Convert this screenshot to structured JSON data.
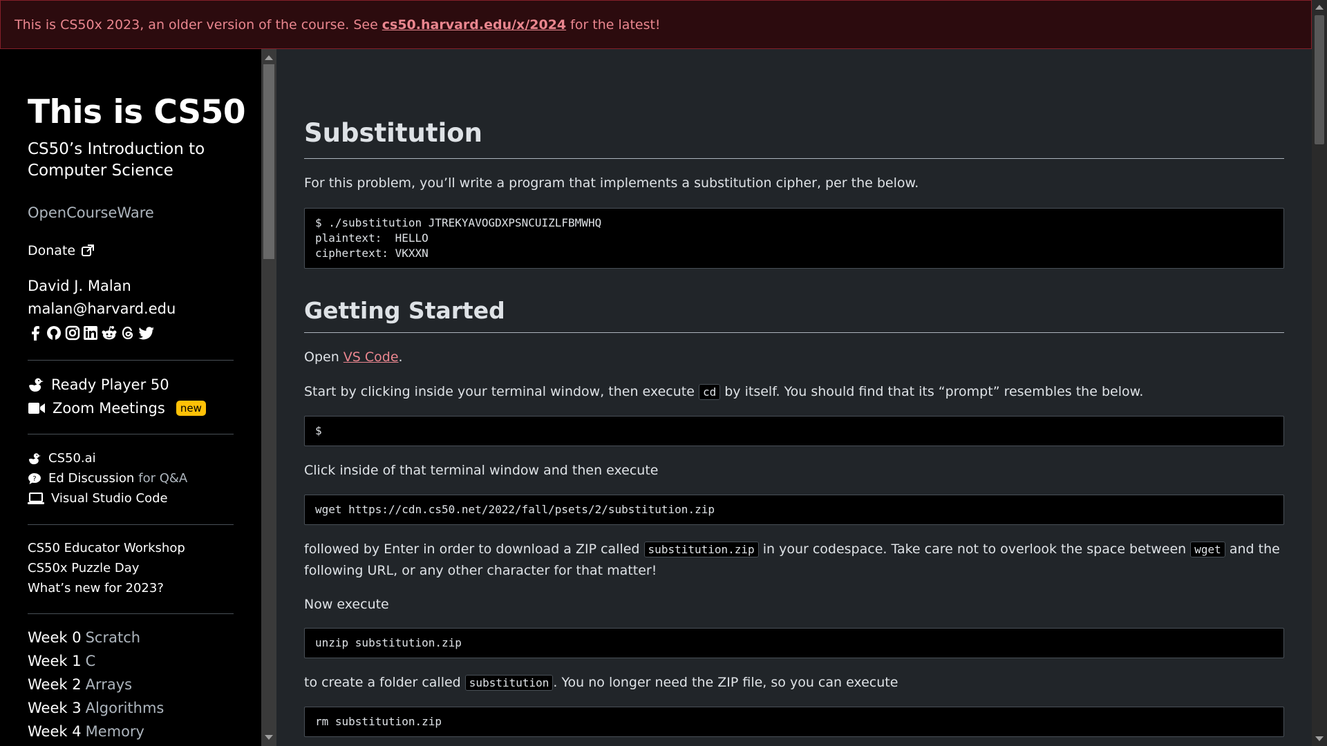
{
  "banner": {
    "text_before": "This is CS50x 2023, an older version of the course. See",
    "link": "cs50.harvard.edu/x/2024",
    "text_after": "for the latest!"
  },
  "sidebar": {
    "title": "This is CS50",
    "subtitle": "CS50’s Introduction to Computer Science",
    "ocw": "OpenCourseWare",
    "donate": "Donate",
    "author": "David J. Malan",
    "email": "malan@harvard.edu",
    "social_icons": [
      "facebook-icon",
      "github-icon",
      "instagram-icon",
      "linkedin-icon",
      "reddit-icon",
      "threads-icon",
      "twitter-icon"
    ],
    "primary_links": [
      {
        "label": "Ready Player 50",
        "icon": "duck-icon"
      },
      {
        "label": "Zoom Meetings",
        "icon": "video-camera-icon",
        "badge": "new"
      }
    ],
    "tool_links": [
      {
        "label": "CS50.ai",
        "icon": "duck-icon"
      },
      {
        "label": "Ed Discussion",
        "suffix": "for Q&A",
        "icon": "chat-icon"
      },
      {
        "label": "Visual Studio Code",
        "icon": "laptop-icon"
      }
    ],
    "extra_links": [
      "CS50 Educator Workshop",
      "CS50x Puzzle Day",
      "What’s new for 2023?"
    ],
    "weeks": [
      {
        "num": "Week 0",
        "topic": "Scratch"
      },
      {
        "num": "Week 1",
        "topic": "C"
      },
      {
        "num": "Week 2",
        "topic": "Arrays"
      },
      {
        "num": "Week 3",
        "topic": "Algorithms"
      },
      {
        "num": "Week 4",
        "topic": "Memory"
      }
    ]
  },
  "main": {
    "title": "Substitution",
    "intro": "For this problem, you’ll write a program that implements a substitution cipher, per the below.",
    "example_code": "$ ./substitution JTREKYAVOGDXPSNCUIZLFBMWHQ\nplaintext:  HELLO\nciphertext: VKXXN",
    "getting_started": {
      "heading": "Getting Started",
      "open_text": "Open",
      "open_link": "VS Code",
      "open_after": ".",
      "step1_before": "Start by clicking inside your terminal window, then execute",
      "step1_code": "cd",
      "step1_after": "by itself. You should find that its “prompt” resembles the below.",
      "prompt_code": "$",
      "step2": "Click inside of that terminal window and then execute",
      "wget_code": "wget https://cdn.cs50.net/2022/fall/psets/2/substitution.zip",
      "step3_a": "followed by Enter in order to download a ZIP called",
      "step3_code1": "substitution.zip",
      "step3_b": "in your codespace. Take care not to overlook the space between",
      "step3_code2": "wget",
      "step3_c": "and the following URL, or any other character for that matter!",
      "step4": "Now execute",
      "unzip_code": "unzip substitution.zip",
      "step5_a": "to create a folder called",
      "step5_code": "substitution",
      "step5_b": ". You no longer need the ZIP file, so you can execute",
      "rm_code": "rm substitution.zip"
    }
  },
  "colors": {
    "banner_bg": "#2c0b0e",
    "banner_text": "#ea868f",
    "link": "#ea868f",
    "badge": "#ffc107"
  }
}
